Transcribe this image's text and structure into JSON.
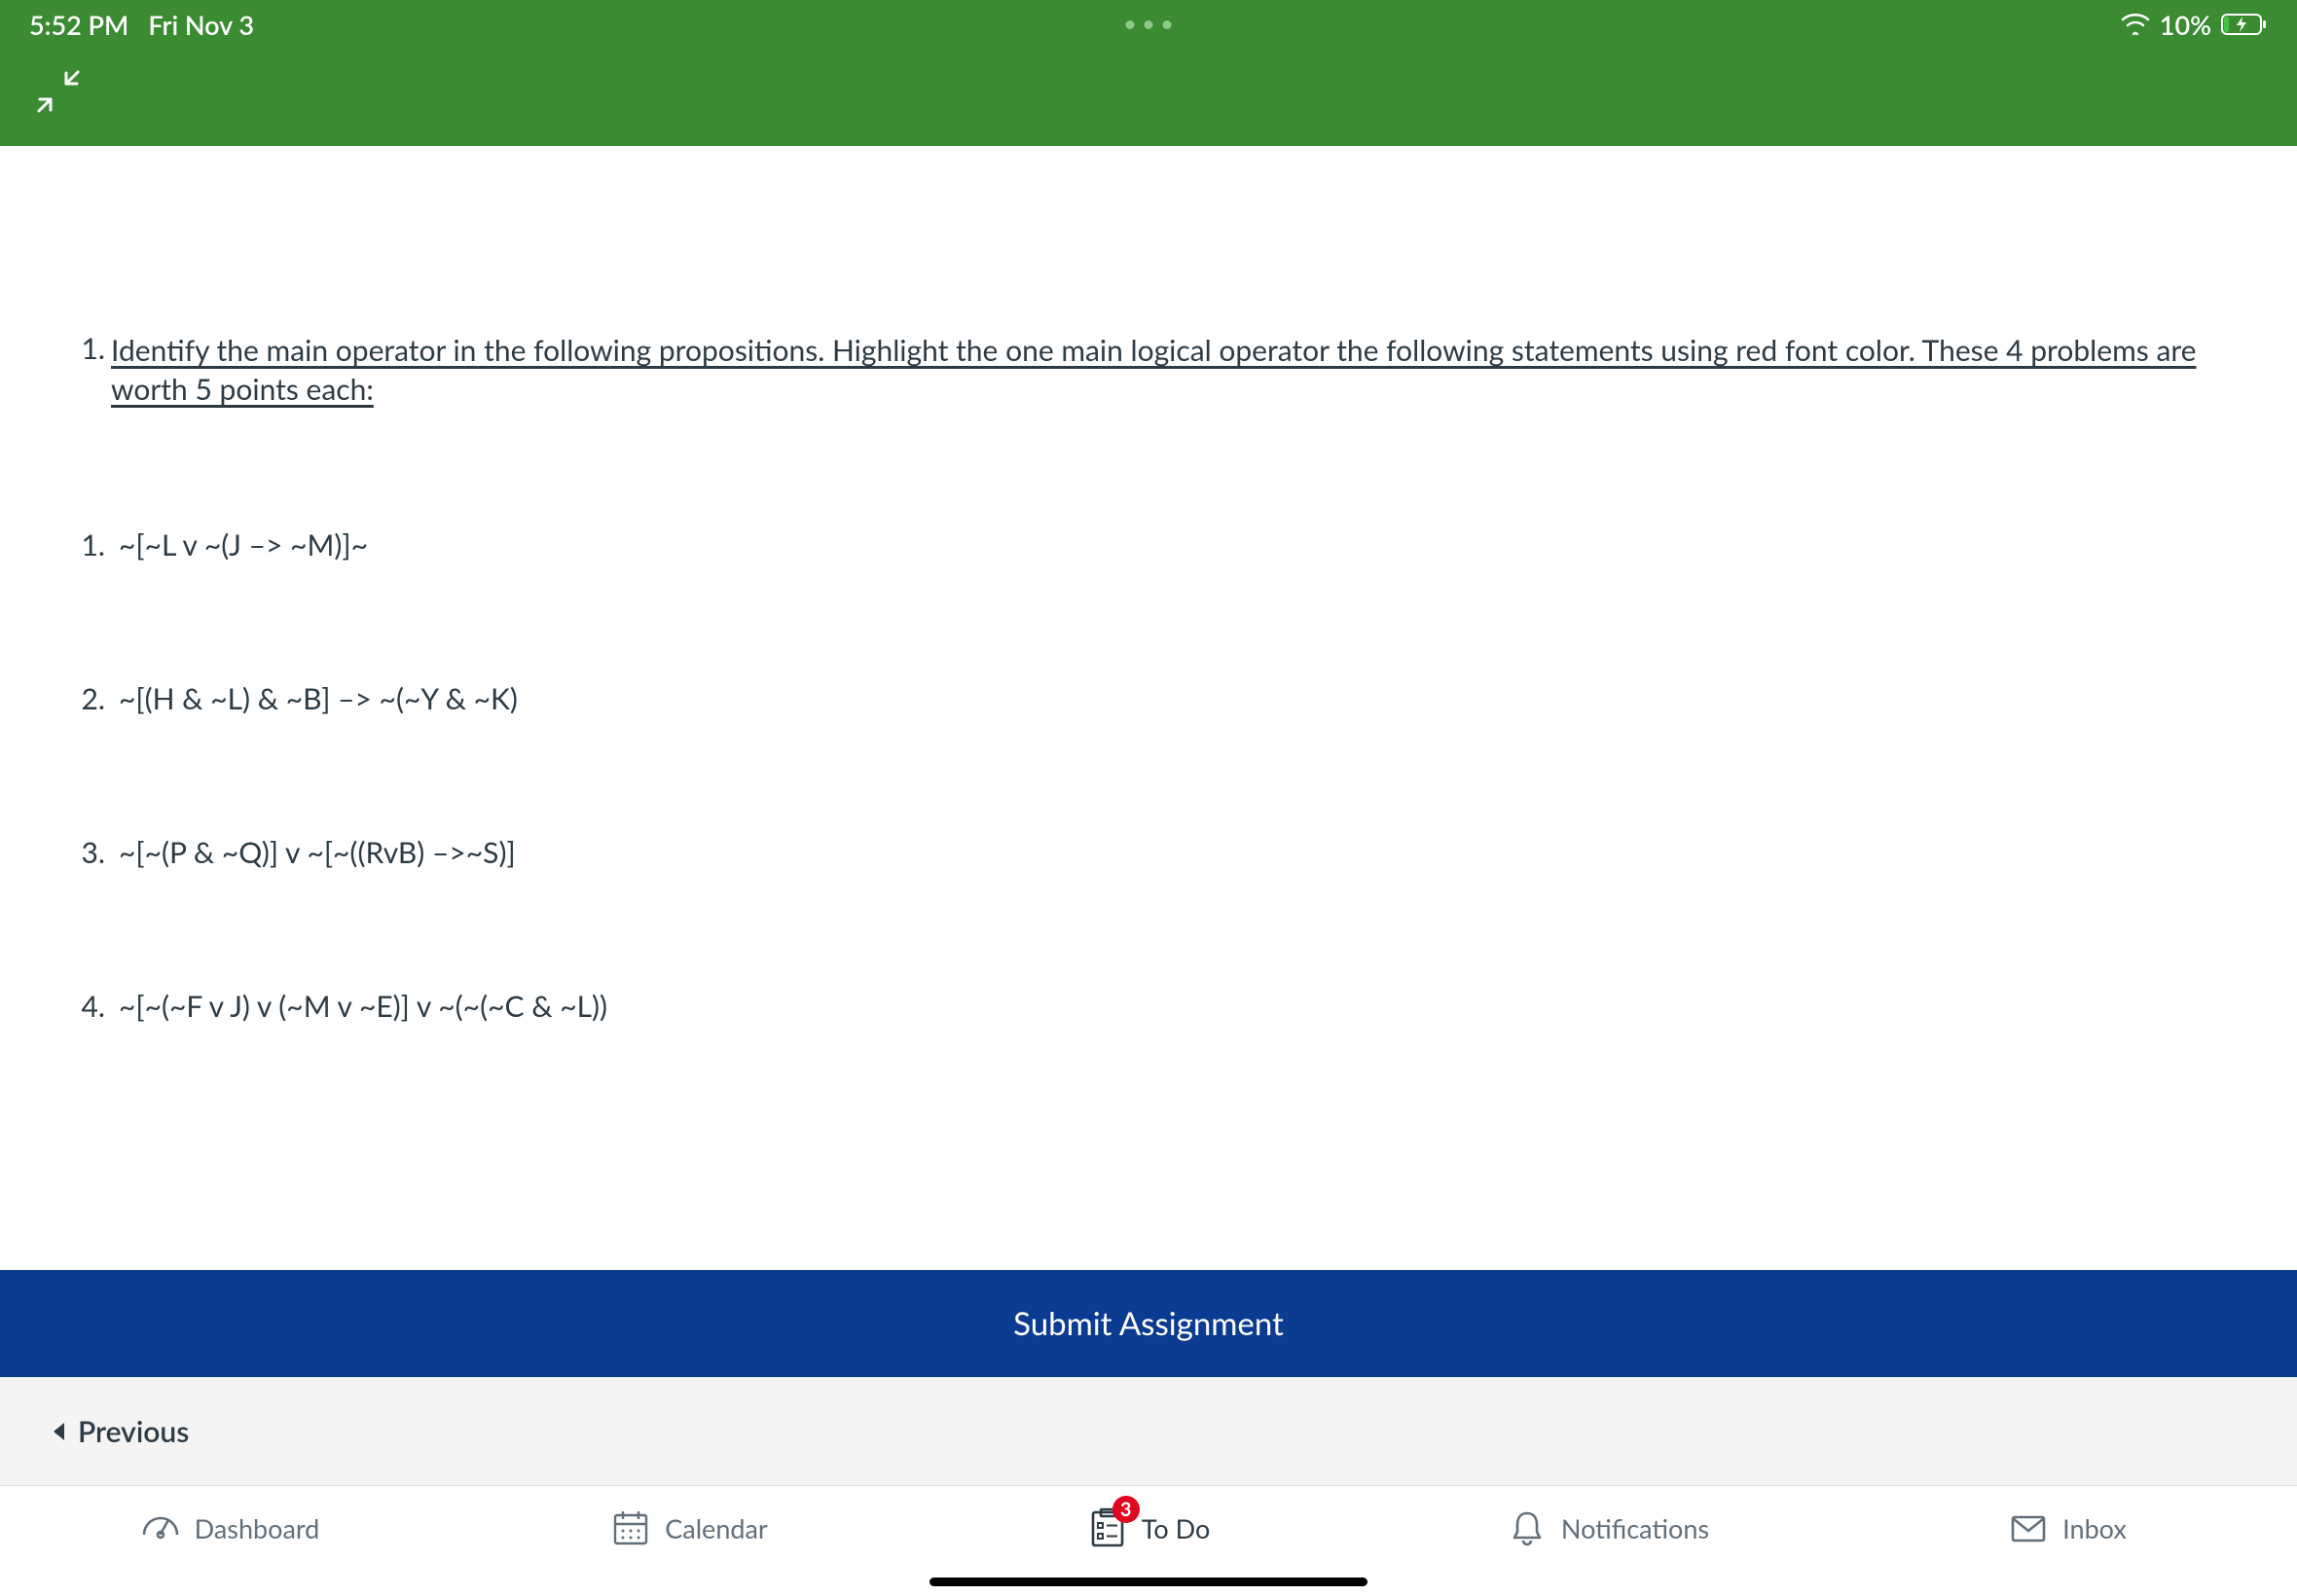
{
  "status": {
    "time": "5:52 PM",
    "date": "Fri Nov 3",
    "battery_pct": "10%"
  },
  "content": {
    "instruction_number": "1.",
    "instruction_text": "Identify the main operator in the following propositions. Highlight the one main logical operator the following statements using red font color. These 4 problems are worth 5 points each:",
    "problems": [
      {
        "num": "1.",
        "expr": "~[~L v ~(J –> ~M)]~"
      },
      {
        "num": "2.",
        "expr": "~[(H & ~L) & ~B] –> ~(~Y & ~K)"
      },
      {
        "num": "3.",
        "expr": "~[~(P & ~Q)] v ~[~((RvB) –>~S)]"
      },
      {
        "num": "4.",
        "expr": "~[~(~F v J) v (~M v ~E)] v ~(~(~C & ~L))"
      }
    ]
  },
  "actions": {
    "submit_label": "Submit Assignment",
    "previous_label": "Previous"
  },
  "tabs": {
    "dashboard": "Dashboard",
    "calendar": "Calendar",
    "todo": "To Do",
    "todo_badge": "3",
    "notifications": "Notifications",
    "inbox": "Inbox"
  }
}
